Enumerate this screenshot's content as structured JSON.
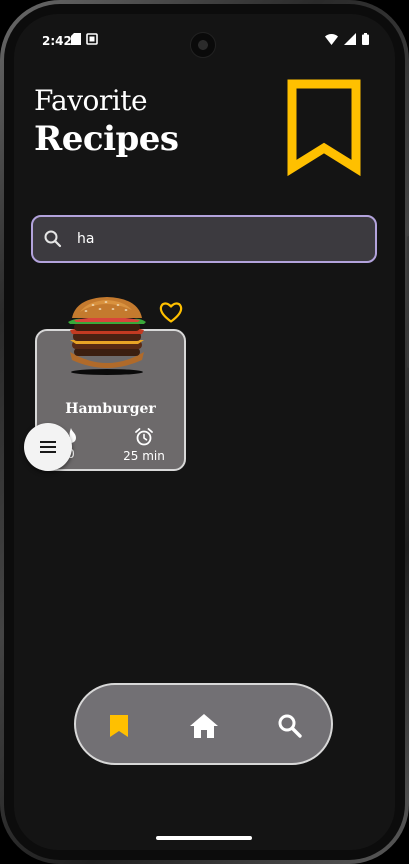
{
  "status_bar": {
    "time": "2:42"
  },
  "header": {
    "title_line1": "Favorite",
    "title_line2": "Recipes"
  },
  "search": {
    "value": "ha",
    "placeholder": ""
  },
  "recipes": [
    {
      "name": "Hamburger",
      "calories": "0",
      "time": "25 min",
      "favorite": true
    }
  ],
  "bottom_nav": {
    "items": [
      {
        "icon": "bookmark-icon",
        "active": true
      },
      {
        "icon": "home-icon",
        "active": false
      },
      {
        "icon": "search-icon",
        "active": false
      }
    ]
  },
  "colors": {
    "accent": "#FFC000",
    "background": "#141414",
    "card": "#6D6A6B",
    "search_border": "#B3A3DC",
    "nav": "#727074"
  }
}
